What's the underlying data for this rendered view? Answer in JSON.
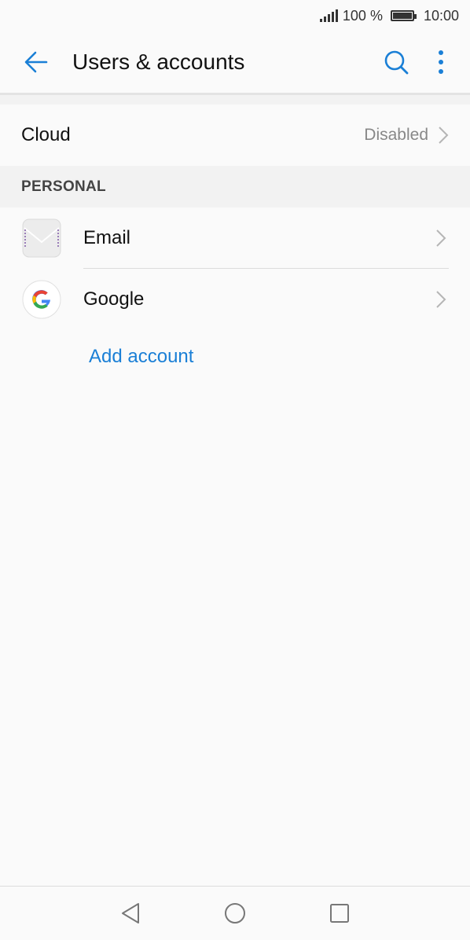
{
  "status_bar": {
    "battery_percent": "100 %",
    "time": "10:00"
  },
  "app_bar": {
    "title": "Users & accounts",
    "icons": [
      "back-arrow-icon",
      "search-icon",
      "more-vert-icon"
    ],
    "accent_color": "#1a7fd6"
  },
  "cloud": {
    "label": "Cloud",
    "status": "Disabled"
  },
  "personal": {
    "header": "PERSONAL",
    "accounts": [
      {
        "label": "Email",
        "icon": "email-app-icon"
      },
      {
        "label": "Google",
        "icon": "google-g-icon"
      }
    ],
    "add_account_label": "Add account"
  },
  "nav_bar": {
    "icons": [
      "back-triangle-icon",
      "home-circle-icon",
      "recents-square-icon"
    ]
  }
}
